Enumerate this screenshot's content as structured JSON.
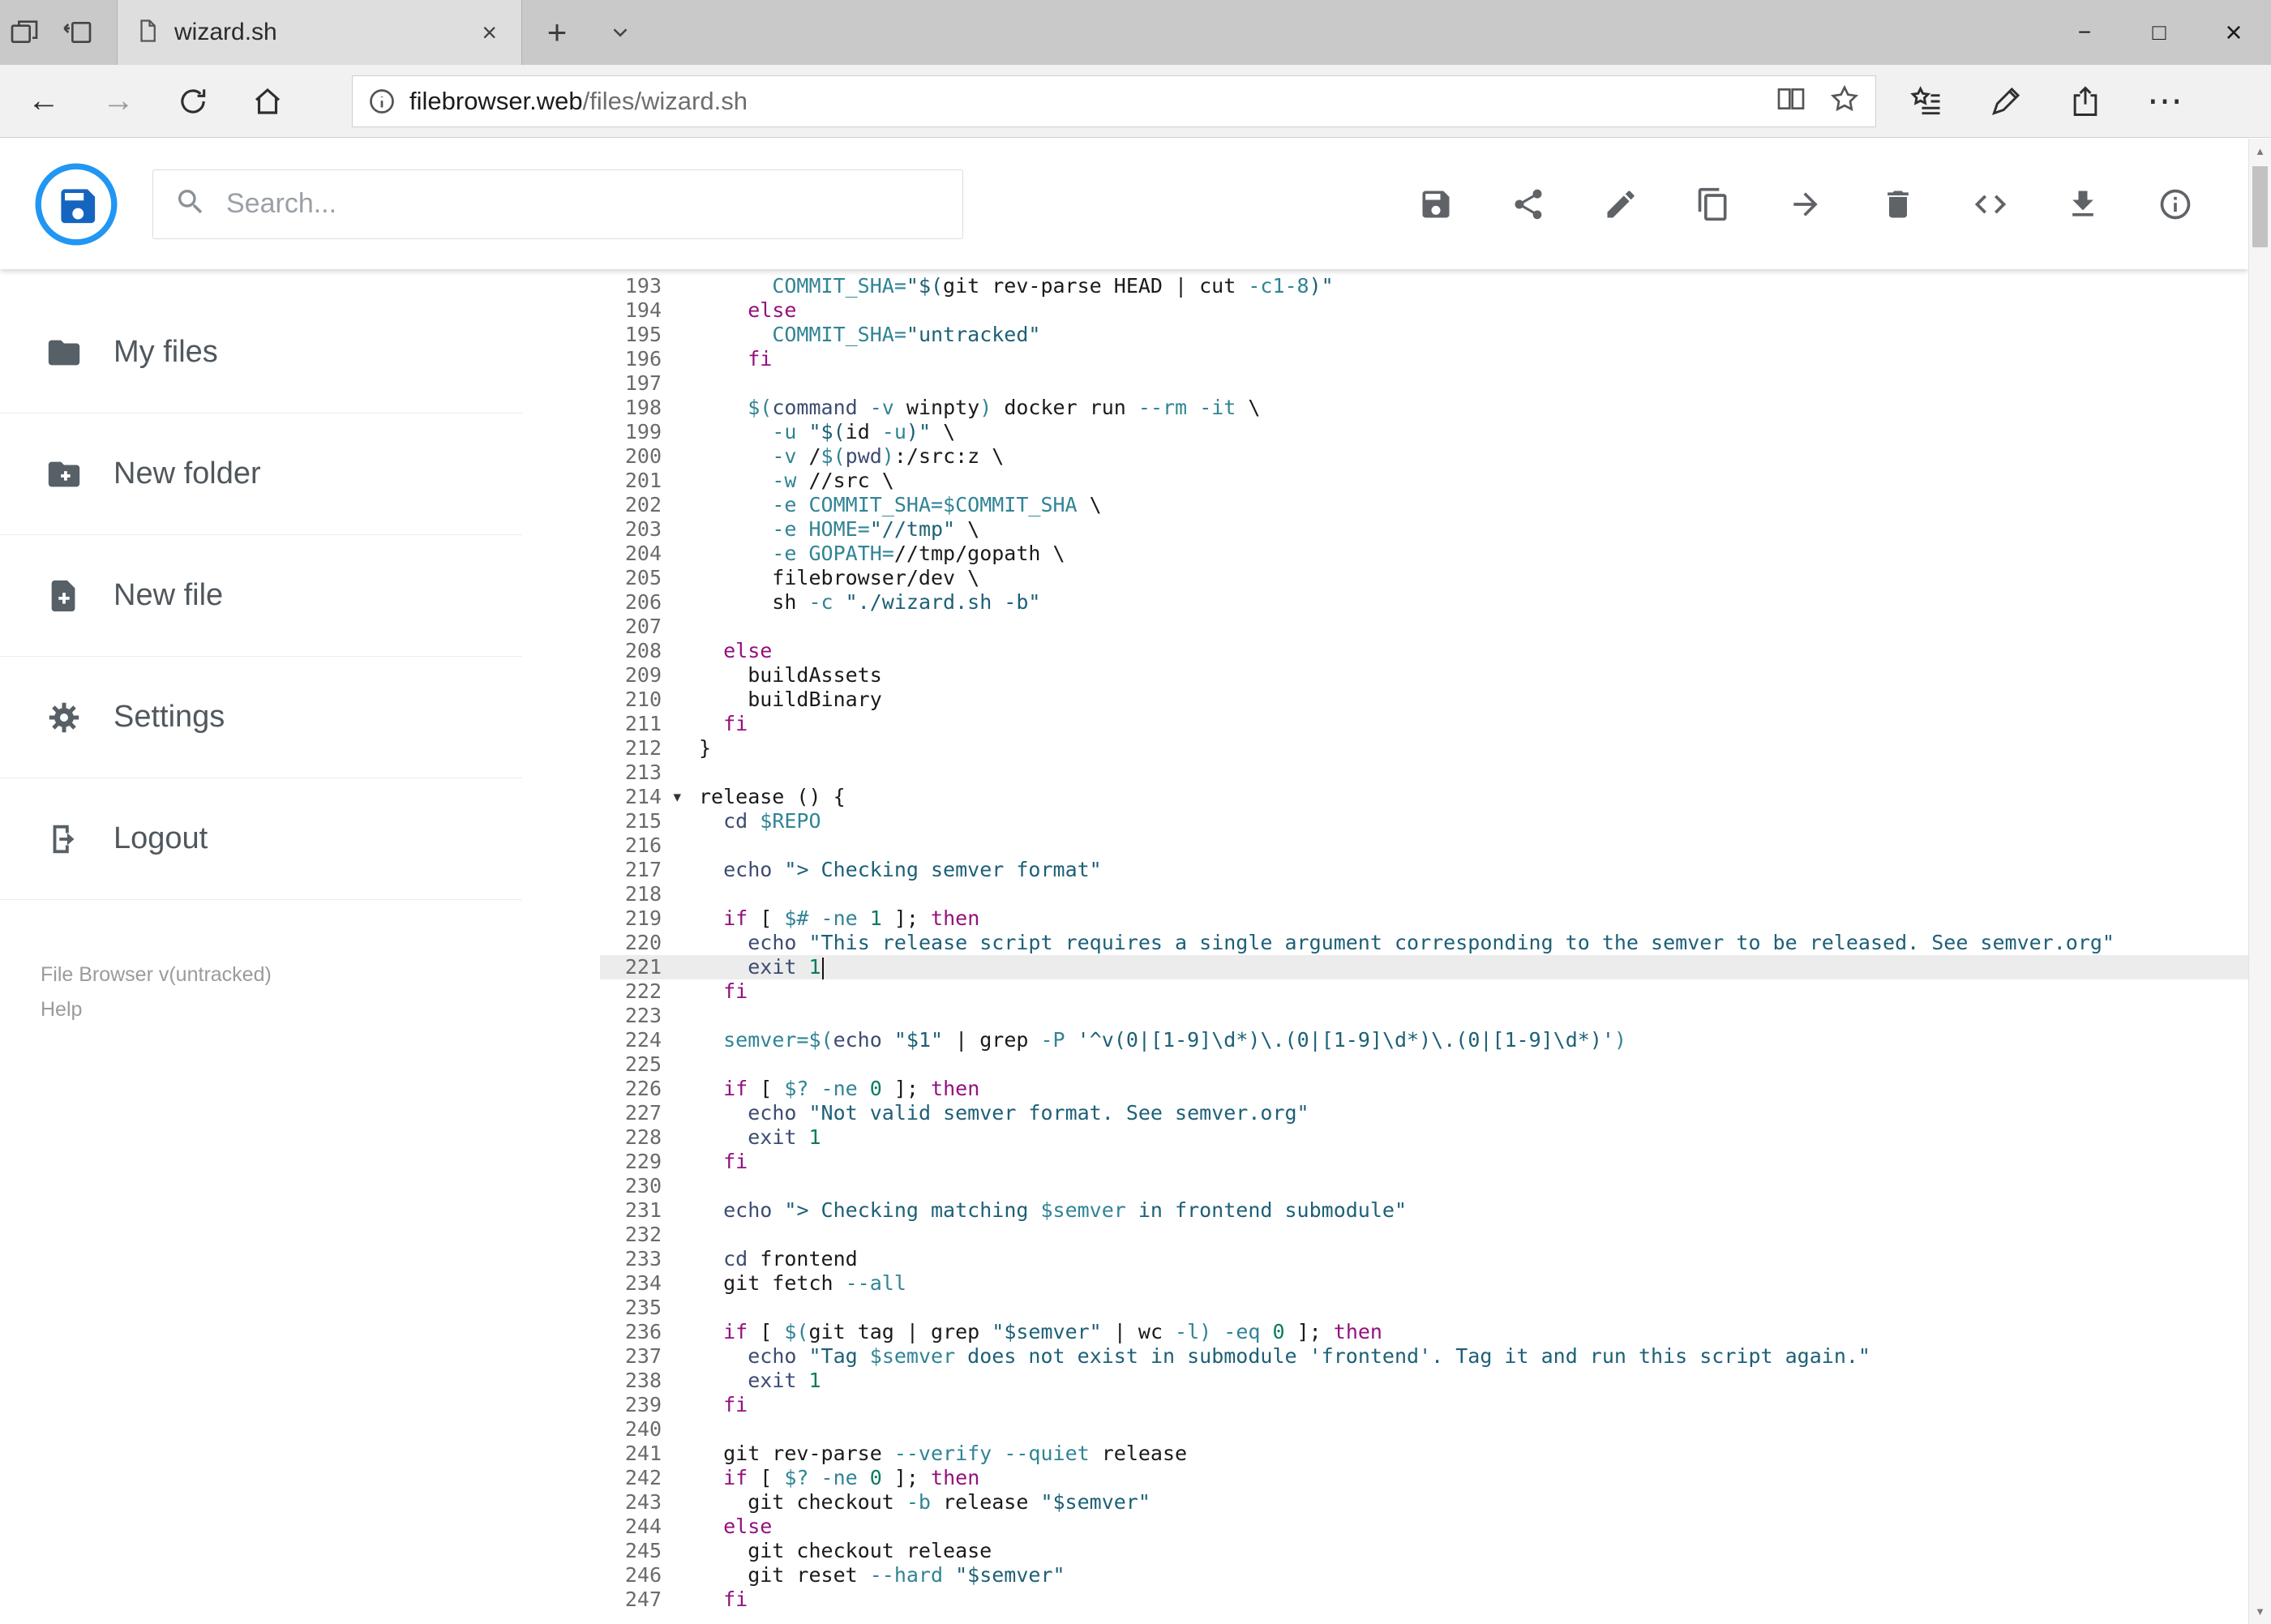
{
  "colors": {
    "accent": "#2196f3",
    "keyword": "#93117e",
    "string": "#1d6077",
    "variable": "#318495",
    "number": "#0c7a5e",
    "builtin": "#3c4c72"
  },
  "icons": {
    "back": "←",
    "forward": "→",
    "minimize": "−",
    "maximize": "□",
    "close": "×",
    "tab_close": "×",
    "new_tab": "+",
    "more": "⋯",
    "fold_arrow": "▾",
    "scroll_up": "▲",
    "scroll_down": "▼"
  },
  "browser": {
    "tab_title": "wizard.sh",
    "url_domain": "filebrowser.web",
    "url_path": "/files/wizard.sh"
  },
  "header": {
    "search_placeholder": "Search..."
  },
  "sidebar": {
    "items": [
      {
        "label": "My files"
      },
      {
        "label": "New folder"
      },
      {
        "label": "New file"
      },
      {
        "label": "Settings"
      },
      {
        "label": "Logout"
      }
    ],
    "version": "File Browser v(untracked)",
    "help": "Help"
  },
  "editor": {
    "active_line": 221,
    "cursor_line": 221,
    "fold_line": 214,
    "lines": [
      {
        "n": 193,
        "t": [
          [
            "p",
            "      "
          ],
          [
            "v",
            "COMMIT_SHA="
          ],
          [
            "s",
            "\"$("
          ],
          [
            "p",
            "git rev-parse HEAD | cut "
          ],
          [
            "f",
            "-c1-8"
          ],
          [
            "s",
            ")\""
          ]
        ]
      },
      {
        "n": 194,
        "t": [
          [
            "p",
            "    "
          ],
          [
            "k",
            "else"
          ]
        ]
      },
      {
        "n": 195,
        "t": [
          [
            "p",
            "      "
          ],
          [
            "v",
            "COMMIT_SHA="
          ],
          [
            "s",
            "\"untracked\""
          ]
        ]
      },
      {
        "n": 196,
        "t": [
          [
            "p",
            "    "
          ],
          [
            "k",
            "fi"
          ]
        ]
      },
      {
        "n": 197,
        "t": []
      },
      {
        "n": 198,
        "t": [
          [
            "p",
            "    "
          ],
          [
            "v",
            "$("
          ],
          [
            "b",
            "command"
          ],
          [
            "p",
            " "
          ],
          [
            "f",
            "-v"
          ],
          [
            "p",
            " winpty"
          ],
          [
            "v",
            ")"
          ],
          [
            "p",
            " docker run "
          ],
          [
            "f",
            "--rm"
          ],
          [
            "p",
            " "
          ],
          [
            "f",
            "-it"
          ],
          [
            "p",
            " \\"
          ]
        ]
      },
      {
        "n": 199,
        "t": [
          [
            "p",
            "      "
          ],
          [
            "f",
            "-u"
          ],
          [
            "p",
            " "
          ],
          [
            "s",
            "\"$("
          ],
          [
            "p",
            "id "
          ],
          [
            "f",
            "-u"
          ],
          [
            "s",
            ")\""
          ],
          [
            "p",
            " \\"
          ]
        ]
      },
      {
        "n": 200,
        "t": [
          [
            "p",
            "      "
          ],
          [
            "f",
            "-v"
          ],
          [
            "p",
            " /"
          ],
          [
            "v",
            "$("
          ],
          [
            "b",
            "pwd"
          ],
          [
            "v",
            ")"
          ],
          [
            "p",
            ":/src:z \\"
          ]
        ]
      },
      {
        "n": 201,
        "t": [
          [
            "p",
            "      "
          ],
          [
            "f",
            "-w"
          ],
          [
            "p",
            " //src \\"
          ]
        ]
      },
      {
        "n": 202,
        "t": [
          [
            "p",
            "      "
          ],
          [
            "f",
            "-e"
          ],
          [
            "p",
            " "
          ],
          [
            "v",
            "COMMIT_SHA=$COMMIT_SHA"
          ],
          [
            "p",
            " \\"
          ]
        ]
      },
      {
        "n": 203,
        "t": [
          [
            "p",
            "      "
          ],
          [
            "f",
            "-e"
          ],
          [
            "p",
            " "
          ],
          [
            "v",
            "HOME="
          ],
          [
            "s",
            "\"//tmp\""
          ],
          [
            "p",
            " \\"
          ]
        ]
      },
      {
        "n": 204,
        "t": [
          [
            "p",
            "      "
          ],
          [
            "f",
            "-e"
          ],
          [
            "p",
            " "
          ],
          [
            "v",
            "GOPATH="
          ],
          [
            "p",
            "//tmp/gopath \\"
          ]
        ]
      },
      {
        "n": 205,
        "t": [
          [
            "p",
            "      filebrowser/dev \\"
          ]
        ]
      },
      {
        "n": 206,
        "t": [
          [
            "p",
            "      sh "
          ],
          [
            "f",
            "-c"
          ],
          [
            "p",
            " "
          ],
          [
            "s",
            "\"./wizard.sh -b\""
          ]
        ]
      },
      {
        "n": 207,
        "t": []
      },
      {
        "n": 208,
        "t": [
          [
            "p",
            "  "
          ],
          [
            "k",
            "else"
          ]
        ]
      },
      {
        "n": 209,
        "t": [
          [
            "p",
            "    buildAssets"
          ]
        ]
      },
      {
        "n": 210,
        "t": [
          [
            "p",
            "    buildBinary"
          ]
        ]
      },
      {
        "n": 211,
        "t": [
          [
            "p",
            "  "
          ],
          [
            "k",
            "fi"
          ]
        ]
      },
      {
        "n": 212,
        "t": [
          [
            "p",
            "}"
          ]
        ]
      },
      {
        "n": 213,
        "t": []
      },
      {
        "n": 214,
        "t": [
          [
            "p",
            "release () {"
          ]
        ]
      },
      {
        "n": 215,
        "t": [
          [
            "p",
            "  "
          ],
          [
            "b",
            "cd"
          ],
          [
            "p",
            " "
          ],
          [
            "v",
            "$REPO"
          ]
        ]
      },
      {
        "n": 216,
        "t": []
      },
      {
        "n": 217,
        "t": [
          [
            "p",
            "  "
          ],
          [
            "b",
            "echo"
          ],
          [
            "p",
            " "
          ],
          [
            "s",
            "\"> Checking semver format\""
          ]
        ]
      },
      {
        "n": 218,
        "t": []
      },
      {
        "n": 219,
        "t": [
          [
            "p",
            "  "
          ],
          [
            "k",
            "if"
          ],
          [
            "p",
            " [ "
          ],
          [
            "v",
            "$#"
          ],
          [
            "p",
            " "
          ],
          [
            "f",
            "-ne"
          ],
          [
            "p",
            " "
          ],
          [
            "n",
            "1"
          ],
          [
            "p",
            " ]; "
          ],
          [
            "k",
            "then"
          ]
        ]
      },
      {
        "n": 220,
        "t": [
          [
            "p",
            "    "
          ],
          [
            "b",
            "echo"
          ],
          [
            "p",
            " "
          ],
          [
            "s",
            "\"This release script requires a single argument corresponding to the semver to be released. See semver.org\""
          ]
        ]
      },
      {
        "n": 221,
        "t": [
          [
            "p",
            "    "
          ],
          [
            "b",
            "exit"
          ],
          [
            "p",
            " "
          ],
          [
            "n",
            "1"
          ]
        ]
      },
      {
        "n": 222,
        "t": [
          [
            "p",
            "  "
          ],
          [
            "k",
            "fi"
          ]
        ]
      },
      {
        "n": 223,
        "t": []
      },
      {
        "n": 224,
        "t": [
          [
            "p",
            "  "
          ],
          [
            "v",
            "semver=$("
          ],
          [
            "b",
            "echo"
          ],
          [
            "p",
            " "
          ],
          [
            "s",
            "\"$1\""
          ],
          [
            "p",
            " | grep "
          ],
          [
            "f",
            "-P"
          ],
          [
            "p",
            " "
          ],
          [
            "s",
            "'^v(0|[1-9]\\d*)\\.(0|[1-9]\\d*)\\.(0|[1-9]\\d*)'"
          ],
          [
            "v",
            ")"
          ]
        ]
      },
      {
        "n": 225,
        "t": []
      },
      {
        "n": 226,
        "t": [
          [
            "p",
            "  "
          ],
          [
            "k",
            "if"
          ],
          [
            "p",
            " [ "
          ],
          [
            "v",
            "$?"
          ],
          [
            "p",
            " "
          ],
          [
            "f",
            "-ne"
          ],
          [
            "p",
            " "
          ],
          [
            "n",
            "0"
          ],
          [
            "p",
            " ]; "
          ],
          [
            "k",
            "then"
          ]
        ]
      },
      {
        "n": 227,
        "t": [
          [
            "p",
            "    "
          ],
          [
            "b",
            "echo"
          ],
          [
            "p",
            " "
          ],
          [
            "s",
            "\"Not valid semver format. See semver.org\""
          ]
        ]
      },
      {
        "n": 228,
        "t": [
          [
            "p",
            "    "
          ],
          [
            "b",
            "exit"
          ],
          [
            "p",
            " "
          ],
          [
            "n",
            "1"
          ]
        ]
      },
      {
        "n": 229,
        "t": [
          [
            "p",
            "  "
          ],
          [
            "k",
            "fi"
          ]
        ]
      },
      {
        "n": 230,
        "t": []
      },
      {
        "n": 231,
        "t": [
          [
            "p",
            "  "
          ],
          [
            "b",
            "echo"
          ],
          [
            "p",
            " "
          ],
          [
            "s",
            "\"> Checking matching "
          ],
          [
            "v",
            "$semver"
          ],
          [
            "s",
            " in frontend submodule\""
          ]
        ]
      },
      {
        "n": 232,
        "t": []
      },
      {
        "n": 233,
        "t": [
          [
            "p",
            "  "
          ],
          [
            "b",
            "cd"
          ],
          [
            "p",
            " frontend"
          ]
        ]
      },
      {
        "n": 234,
        "t": [
          [
            "p",
            "  git fetch "
          ],
          [
            "f",
            "--all"
          ]
        ]
      },
      {
        "n": 235,
        "t": []
      },
      {
        "n": 236,
        "t": [
          [
            "p",
            "  "
          ],
          [
            "k",
            "if"
          ],
          [
            "p",
            " [ "
          ],
          [
            "v",
            "$("
          ],
          [
            "p",
            "git tag | grep "
          ],
          [
            "s",
            "\"$semver\""
          ],
          [
            "p",
            " | wc "
          ],
          [
            "f",
            "-l"
          ],
          [
            "v",
            ")"
          ],
          [
            "p",
            " "
          ],
          [
            "f",
            "-eq"
          ],
          [
            "p",
            " "
          ],
          [
            "n",
            "0"
          ],
          [
            "p",
            " ]; "
          ],
          [
            "k",
            "then"
          ]
        ]
      },
      {
        "n": 237,
        "t": [
          [
            "p",
            "    "
          ],
          [
            "b",
            "echo"
          ],
          [
            "p",
            " "
          ],
          [
            "s",
            "\"Tag "
          ],
          [
            "v",
            "$semver"
          ],
          [
            "s",
            " does not exist in submodule 'frontend'. Tag it and run this script again.\""
          ]
        ]
      },
      {
        "n": 238,
        "t": [
          [
            "p",
            "    "
          ],
          [
            "b",
            "exit"
          ],
          [
            "p",
            " "
          ],
          [
            "n",
            "1"
          ]
        ]
      },
      {
        "n": 239,
        "t": [
          [
            "p",
            "  "
          ],
          [
            "k",
            "fi"
          ]
        ]
      },
      {
        "n": 240,
        "t": []
      },
      {
        "n": 241,
        "t": [
          [
            "p",
            "  git rev-parse "
          ],
          [
            "f",
            "--verify"
          ],
          [
            "p",
            " "
          ],
          [
            "f",
            "--quiet"
          ],
          [
            "p",
            " release"
          ]
        ]
      },
      {
        "n": 242,
        "t": [
          [
            "p",
            "  "
          ],
          [
            "k",
            "if"
          ],
          [
            "p",
            " [ "
          ],
          [
            "v",
            "$?"
          ],
          [
            "p",
            " "
          ],
          [
            "f",
            "-ne"
          ],
          [
            "p",
            " "
          ],
          [
            "n",
            "0"
          ],
          [
            "p",
            " ]; "
          ],
          [
            "k",
            "then"
          ]
        ]
      },
      {
        "n": 243,
        "t": [
          [
            "p",
            "    git checkout "
          ],
          [
            "f",
            "-b"
          ],
          [
            "p",
            " release "
          ],
          [
            "s",
            "\"$semver\""
          ]
        ]
      },
      {
        "n": 244,
        "t": [
          [
            "p",
            "  "
          ],
          [
            "k",
            "else"
          ]
        ]
      },
      {
        "n": 245,
        "t": [
          [
            "p",
            "    git checkout release"
          ]
        ]
      },
      {
        "n": 246,
        "t": [
          [
            "p",
            "    git reset "
          ],
          [
            "f",
            "--hard"
          ],
          [
            "p",
            " "
          ],
          [
            "s",
            "\"$semver\""
          ]
        ]
      },
      {
        "n": 247,
        "t": [
          [
            "p",
            "  "
          ],
          [
            "k",
            "fi"
          ]
        ]
      }
    ]
  }
}
